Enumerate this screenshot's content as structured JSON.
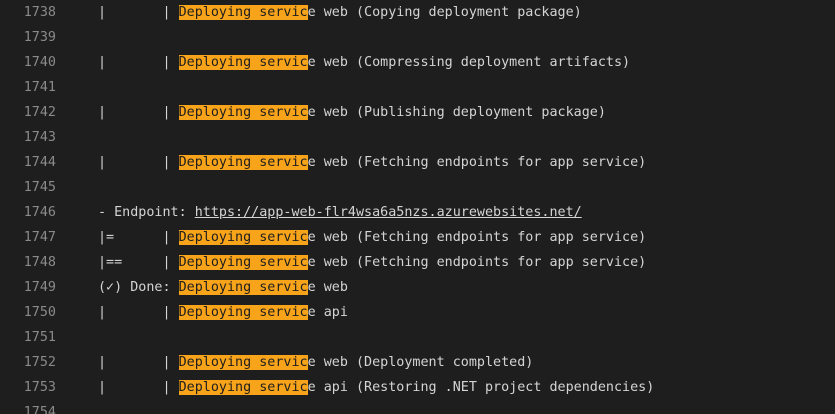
{
  "log": {
    "search_term": "Deploying servic",
    "highlight_color": "#f8a41b",
    "lines": [
      {
        "num": "1738",
        "segments": [
          {
            "t": "|       | "
          },
          {
            "t": "Deploying servic",
            "k": "match"
          },
          {
            "t": "e web (Copying deployment package)"
          }
        ]
      },
      {
        "num": "1739",
        "segments": []
      },
      {
        "num": "1740",
        "segments": [
          {
            "t": "|       | "
          },
          {
            "t": "Deploying servic",
            "k": "match"
          },
          {
            "t": "e web (Compressing deployment artifacts)"
          }
        ]
      },
      {
        "num": "1741",
        "segments": []
      },
      {
        "num": "1742",
        "segments": [
          {
            "t": "|       | "
          },
          {
            "t": "Deploying servic",
            "k": "match"
          },
          {
            "t": "e web (Publishing deployment package)"
          }
        ]
      },
      {
        "num": "1743",
        "segments": []
      },
      {
        "num": "1744",
        "segments": [
          {
            "t": "|       | "
          },
          {
            "t": "Deploying servic",
            "k": "match"
          },
          {
            "t": "e web (Fetching endpoints for app service)"
          }
        ]
      },
      {
        "num": "1745",
        "segments": []
      },
      {
        "num": "1746",
        "segments": [
          {
            "t": "- Endpoint: "
          },
          {
            "t": "https://app-web-flr4wsa6a5nzs.azurewebsites.net/",
            "k": "link"
          }
        ]
      },
      {
        "num": "1747",
        "segments": [
          {
            "t": "|=      | "
          },
          {
            "t": "Deploying servic",
            "k": "match"
          },
          {
            "t": "e web (Fetching endpoints for app service)"
          }
        ]
      },
      {
        "num": "1748",
        "segments": [
          {
            "t": "|==     | "
          },
          {
            "t": "Deploying servic",
            "k": "match"
          },
          {
            "t": "e web (Fetching endpoints for app service)"
          }
        ]
      },
      {
        "num": "1749",
        "segments": [
          {
            "t": "(✓) Done: "
          },
          {
            "t": "Deploying servic",
            "k": "match"
          },
          {
            "t": "e web"
          }
        ]
      },
      {
        "num": "1750",
        "segments": [
          {
            "t": "|       | "
          },
          {
            "t": "Deploying servic",
            "k": "match"
          },
          {
            "t": "e api"
          }
        ]
      },
      {
        "num": "1751",
        "segments": []
      },
      {
        "num": "1752",
        "segments": [
          {
            "t": "|       | "
          },
          {
            "t": "Deploying servic",
            "k": "match"
          },
          {
            "t": "e web (Deployment completed)"
          }
        ]
      },
      {
        "num": "1753",
        "segments": [
          {
            "t": "|       | "
          },
          {
            "t": "Deploying servic",
            "k": "match"
          },
          {
            "t": "e api (Restoring .NET project dependencies)"
          }
        ]
      },
      {
        "num": "1754",
        "segments": []
      }
    ]
  }
}
